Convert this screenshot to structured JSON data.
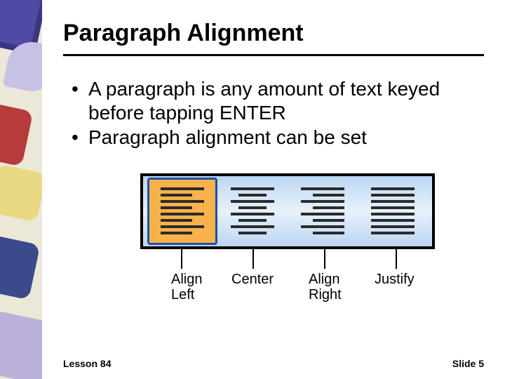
{
  "title": "Paragraph Alignment",
  "bullets": [
    "A paragraph is any amount of text keyed before tapping ENTER",
    "Paragraph alignment can be set"
  ],
  "toolbar": {
    "buttons": [
      {
        "name": "align-left-button",
        "label": "Align\nLeft",
        "selected": true,
        "glyph": "left"
      },
      {
        "name": "align-center-button",
        "label": "Center",
        "selected": false,
        "glyph": "center"
      },
      {
        "name": "align-right-button",
        "label": "Align\nRight",
        "selected": false,
        "glyph": "right"
      },
      {
        "name": "justify-button",
        "label": "Justify",
        "selected": false,
        "glyph": "justify"
      }
    ]
  },
  "footer": {
    "lesson": "Lesson 84",
    "slide": "Slide 5"
  }
}
